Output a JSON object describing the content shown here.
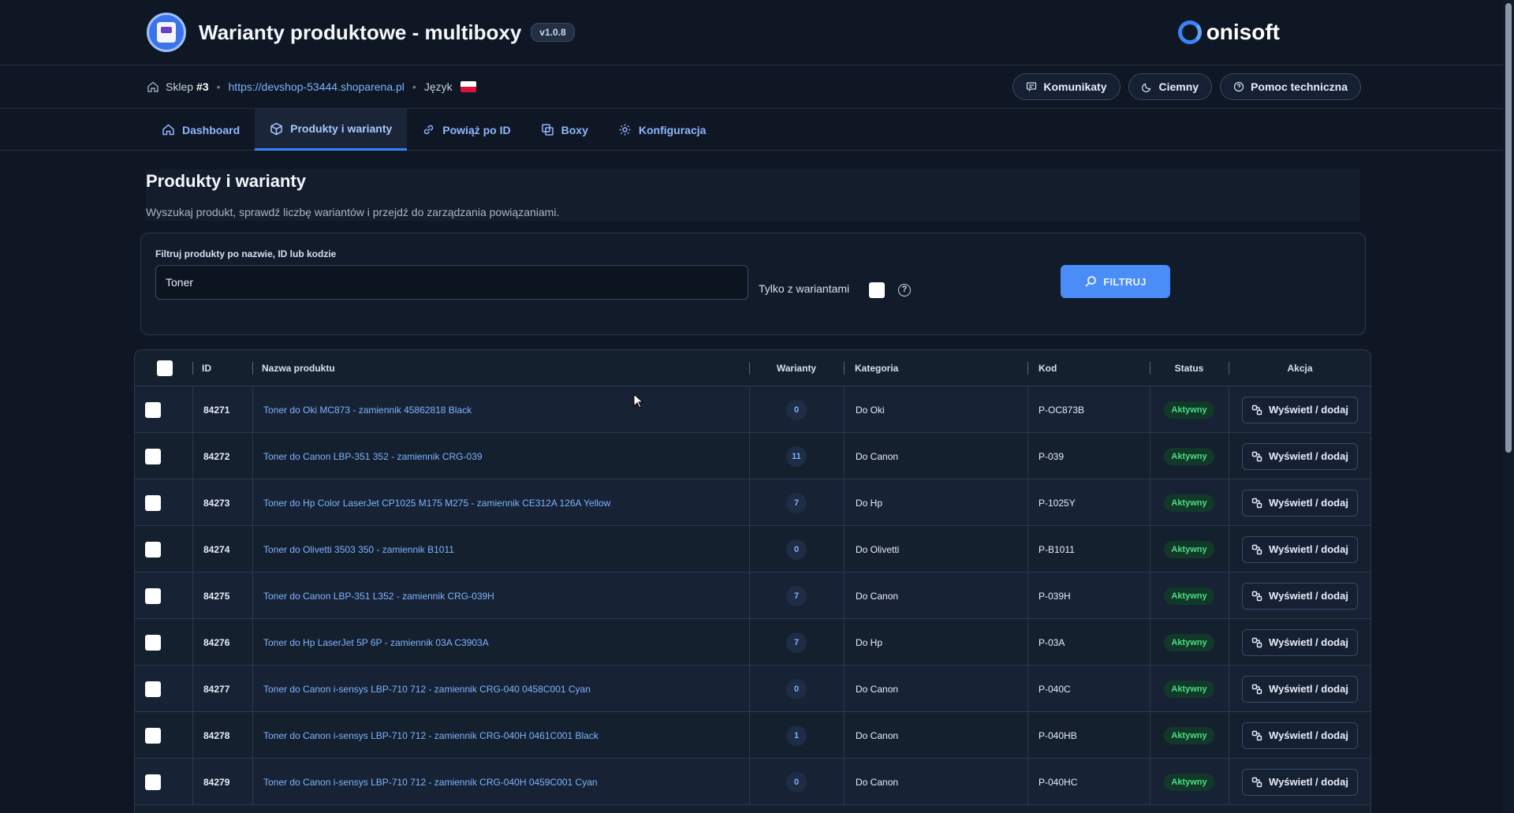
{
  "app": {
    "title": "Warianty produktowe - multiboxy",
    "version": "v1.0.8",
    "brand": "onisoft"
  },
  "info": {
    "shop_label": "Sklep",
    "shop_number": "#3",
    "separator": "•",
    "shop_url": "https://devshop-53444.shoparena.pl",
    "language_label": "Język"
  },
  "header_actions": {
    "messages": "Komunikaty",
    "theme": "Ciemny",
    "support": "Pomoc techniczna"
  },
  "nav": {
    "dashboard": "Dashboard",
    "products": "Produkty i warianty",
    "link_by_id": "Powiąż po ID",
    "boxes": "Boxy",
    "config": "Konfiguracja"
  },
  "page": {
    "title": "Produkty i warianty",
    "subtitle": "Wyszukaj produkt, sprawdź liczbę wariantów i przejdź do zarządzania powiązaniami."
  },
  "filter": {
    "label": "Filtruj produkty po nazwie, ID lub kodzie",
    "value": "Toner",
    "only_variants_label": "Tylko z wariantami",
    "help": "?",
    "button": "FILTRUJ"
  },
  "table": {
    "headers": {
      "id": "ID",
      "name": "Nazwa produktu",
      "variants": "Warianty",
      "category": "Kategoria",
      "code": "Kod",
      "status": "Status",
      "action": "Akcja"
    },
    "action_label": "Wyświetl / dodaj",
    "rows": [
      {
        "id": "84271",
        "name": "Toner do Oki MC873 - zamiennik 45862818 Black",
        "variants": "0",
        "category": "Do Oki",
        "code": "P-OC873B",
        "status": "Aktywny"
      },
      {
        "id": "84272",
        "name": "Toner do Canon LBP-351 352 - zamiennik CRG-039",
        "variants": "11",
        "category": "Do Canon",
        "code": "P-039",
        "status": "Aktywny"
      },
      {
        "id": "84273",
        "name": "Toner do Hp Color LaserJet CP1025 M175 M275 - zamiennik CE312A 126A Yellow",
        "variants": "7",
        "category": "Do Hp",
        "code": "P-1025Y",
        "status": "Aktywny"
      },
      {
        "id": "84274",
        "name": "Toner do Olivetti 3503 350 - zamiennik B1011",
        "variants": "0",
        "category": "Do Olivetti",
        "code": "P-B1011",
        "status": "Aktywny"
      },
      {
        "id": "84275",
        "name": "Toner do Canon LBP-351 L352 - zamiennik CRG-039H",
        "variants": "7",
        "category": "Do Canon",
        "code": "P-039H",
        "status": "Aktywny"
      },
      {
        "id": "84276",
        "name": "Toner do Hp LaserJet 5P 6P - zamiennik 03A C3903A",
        "variants": "7",
        "category": "Do Hp",
        "code": "P-03A",
        "status": "Aktywny"
      },
      {
        "id": "84277",
        "name": "Toner do Canon i-sensys LBP-710 712 - zamiennik CRG-040 0458C001 Cyan",
        "variants": "0",
        "category": "Do Canon",
        "code": "P-040C",
        "status": "Aktywny"
      },
      {
        "id": "84278",
        "name": "Toner do Canon i-sensys LBP-710 712 - zamiennik CRG-040H 0461C001 Black",
        "variants": "1",
        "category": "Do Canon",
        "code": "P-040HB",
        "status": "Aktywny"
      },
      {
        "id": "84279",
        "name": "Toner do Canon i-sensys LBP-710 712 - zamiennik CRG-040H 0459C001 Cyan",
        "variants": "0",
        "category": "Do Canon",
        "code": "P-040HC",
        "status": "Aktywny"
      }
    ]
  },
  "colors": {
    "accent": "#4a8df8",
    "link": "#7fb2ff",
    "success": "#4ade80",
    "background": "#0f1724"
  }
}
